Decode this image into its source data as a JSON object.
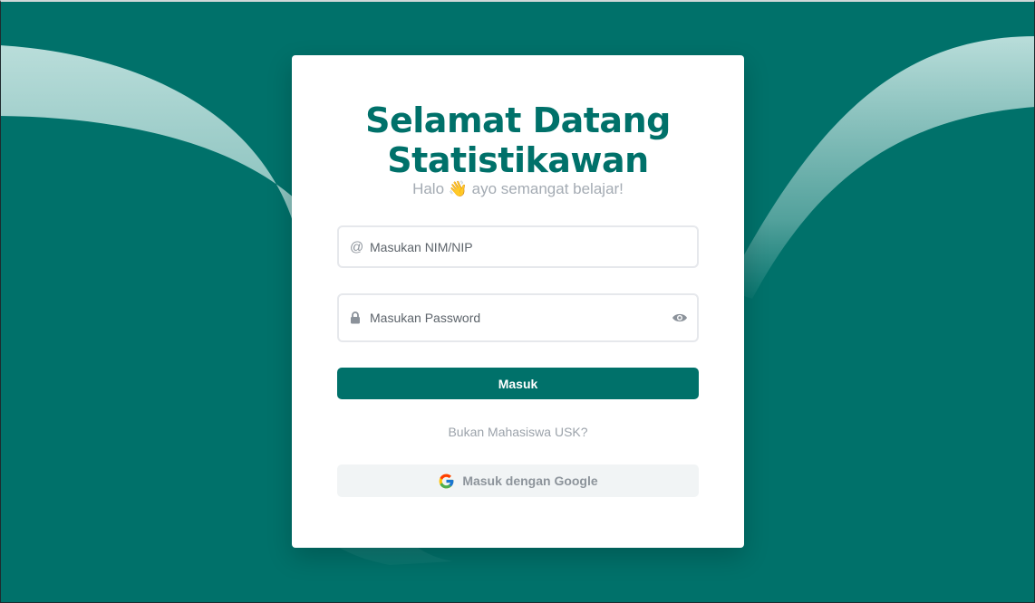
{
  "colors": {
    "brand": "#00716a",
    "card": "#ffffff",
    "muted_text": "#a4abb3",
    "google_button_bg": "#f1f4f5"
  },
  "login": {
    "title_line1": "Selamat Datang",
    "title_line2": "Statistikawan",
    "subtitle": "Halo 👋 ayo semangat belajar!",
    "nim_field": {
      "icon": "at-icon",
      "placeholder": "Masukan NIM/NIP",
      "value": ""
    },
    "password_field": {
      "icon": "lock-icon",
      "placeholder": "Masukan Password",
      "value": "",
      "toggle_icon": "eye-icon"
    },
    "submit_label": "Masuk",
    "alt_link": "Bukan Mahasiswa USK?",
    "google_label": "Masuk dengan Google",
    "google_icon": "google-icon"
  }
}
